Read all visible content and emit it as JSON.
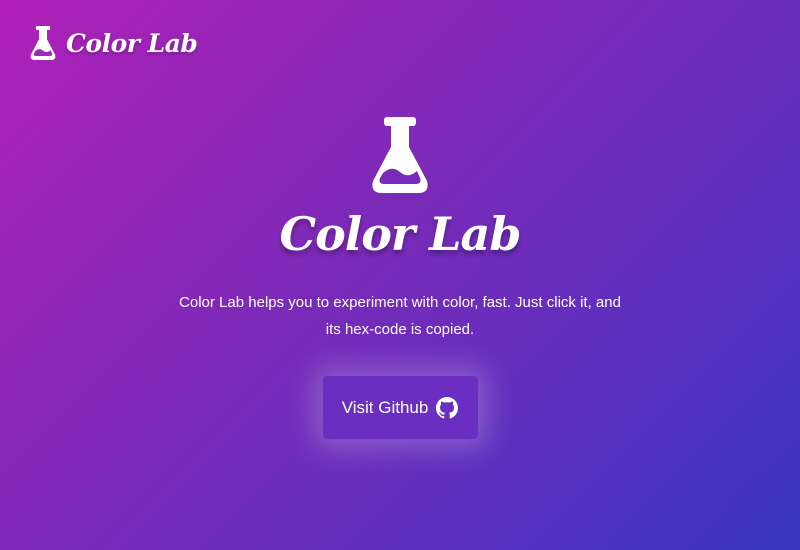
{
  "brand": {
    "name": "Color Lab",
    "icon": "flask-icon"
  },
  "hero": {
    "icon": "flask-icon",
    "title": "Color Lab",
    "tagline": "Color Lab helps you to experiment with color, fast. Just click it, and its hex-code is copied."
  },
  "cta": {
    "label": "Visit Github",
    "icon": "github-icon"
  },
  "colors": {
    "gradient_start": "#b020b8",
    "gradient_end": "#3535c0",
    "button_bg": "#6a2fc0",
    "text": "#ffffff"
  }
}
